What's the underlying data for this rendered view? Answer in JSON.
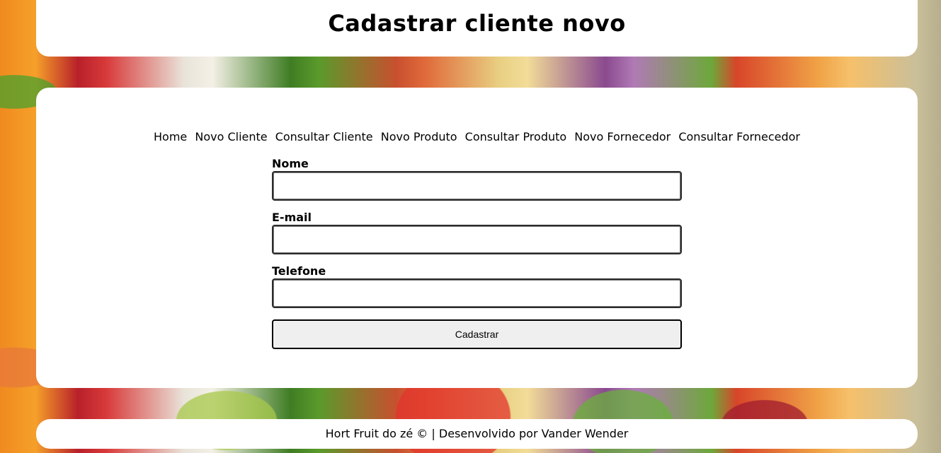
{
  "header": {
    "title": "Cadastrar cliente novo"
  },
  "nav": {
    "items": [
      {
        "label": "Home"
      },
      {
        "label": "Novo Cliente"
      },
      {
        "label": "Consultar Cliente"
      },
      {
        "label": "Novo Produto"
      },
      {
        "label": "Consultar Produto"
      },
      {
        "label": "Novo Fornecedor"
      },
      {
        "label": "Consultar Fornecedor"
      }
    ]
  },
  "form": {
    "fields": [
      {
        "label": "Nome",
        "value": "",
        "placeholder": ""
      },
      {
        "label": "E-mail",
        "value": "",
        "placeholder": ""
      },
      {
        "label": "Telefone",
        "value": "",
        "placeholder": ""
      }
    ],
    "submit_label": "Cadastrar"
  },
  "footer": {
    "text": "Hort Fruit do zé © | Desenvolvido por Vander Wender"
  },
  "colors": {
    "panel_background": "#ffffff",
    "button_background": "#efefef",
    "text": "#000000"
  }
}
